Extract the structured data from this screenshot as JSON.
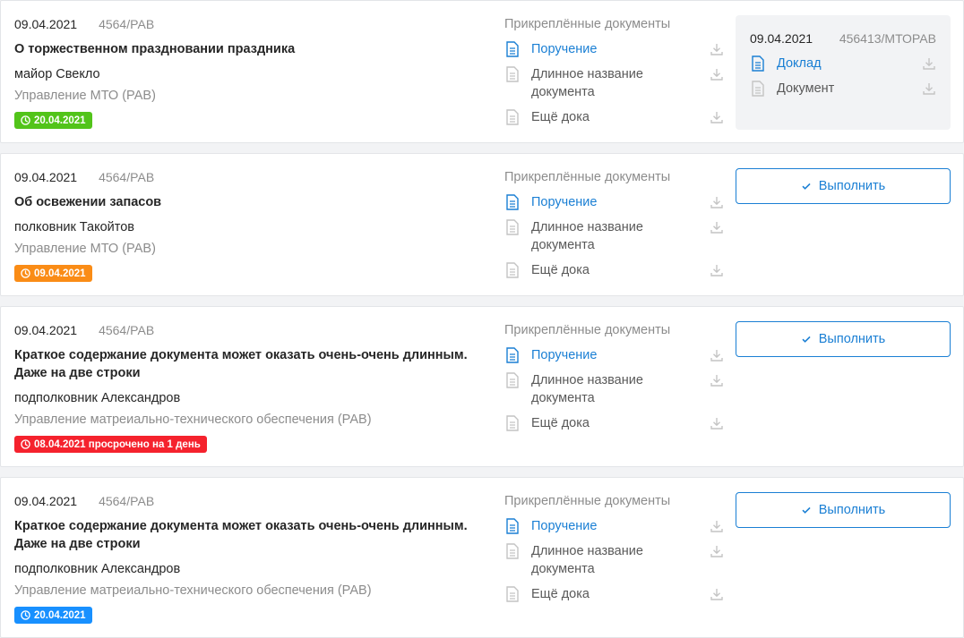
{
  "colors": {
    "accent": "#1a7fd4",
    "green": "#52c41a",
    "orange": "#fa8c16",
    "red": "#f5222d",
    "blue": "#1890ff"
  },
  "cards": [
    {
      "date": "09.04.2021",
      "number": "4564/РАВ",
      "title_lines": [
        "О торжественном праздновании праздника"
      ],
      "person": "майор Свекло",
      "department": "Управление МТО (РАВ)",
      "badge": {
        "text": "20.04.2021",
        "color": "green"
      },
      "attachments_label": "Прикреплённые документы",
      "documents": [
        {
          "name_lines": [
            "Поручение"
          ],
          "active": true
        },
        {
          "name_lines": [
            "Длинное название",
            "документа"
          ],
          "active": false
        },
        {
          "name_lines": [
            "Ещё дока"
          ],
          "active": false
        }
      ],
      "panel": {
        "date": "09.04.2021",
        "number": "456413/МТОРАВ",
        "documents": [
          {
            "name": "Доклад",
            "active": true
          },
          {
            "name": "Документ",
            "active": false
          }
        ]
      }
    },
    {
      "date": "09.04.2021",
      "number": "4564/РАВ",
      "title_lines": [
        "Об освежении запасов"
      ],
      "person": "полковник Такойтов",
      "department": "Управление МТО (РАВ)",
      "badge": {
        "text": "09.04.2021",
        "color": "orange"
      },
      "attachments_label": "Прикреплённые документы",
      "documents": [
        {
          "name_lines": [
            "Поручение"
          ],
          "active": true
        },
        {
          "name_lines": [
            "Длинное название",
            "документа"
          ],
          "active": false
        },
        {
          "name_lines": [
            "Ещё дока"
          ],
          "active": false
        }
      ],
      "action_label": "Выполнить"
    },
    {
      "date": "09.04.2021",
      "number": "4564/РАВ",
      "title_lines": [
        "Краткое содержание документа может оказать очень-очень длинным.",
        "Даже на две строки"
      ],
      "person": "подполковник Александров",
      "department": "Управление матреиально-технического обеспечения (РАВ)",
      "badge": {
        "text": "08.04.2021 просрочено на 1 день",
        "color": "red"
      },
      "attachments_label": "Прикреплённые документы",
      "documents": [
        {
          "name_lines": [
            "Поручение"
          ],
          "active": true
        },
        {
          "name_lines": [
            "Длинное название",
            "документа"
          ],
          "active": false
        },
        {
          "name_lines": [
            "Ещё дока"
          ],
          "active": false
        }
      ],
      "action_label": "Выполнить"
    },
    {
      "date": "09.04.2021",
      "number": "4564/РАВ",
      "title_lines": [
        "Краткое содержание документа может оказать очень-очень длинным.",
        "Даже на две строки"
      ],
      "person": "подполковник Александров",
      "department": "Управление матреиально-технического обеспечения (РАВ)",
      "badge": {
        "text": "20.04.2021",
        "color": "blue"
      },
      "attachments_label": "Прикреплённые документы",
      "documents": [
        {
          "name_lines": [
            "Поручение"
          ],
          "active": true
        },
        {
          "name_lines": [
            "Длинное название",
            "документа"
          ],
          "active": false
        },
        {
          "name_lines": [
            "Ещё дока"
          ],
          "active": false
        }
      ],
      "action_label": "Выполнить"
    }
  ]
}
